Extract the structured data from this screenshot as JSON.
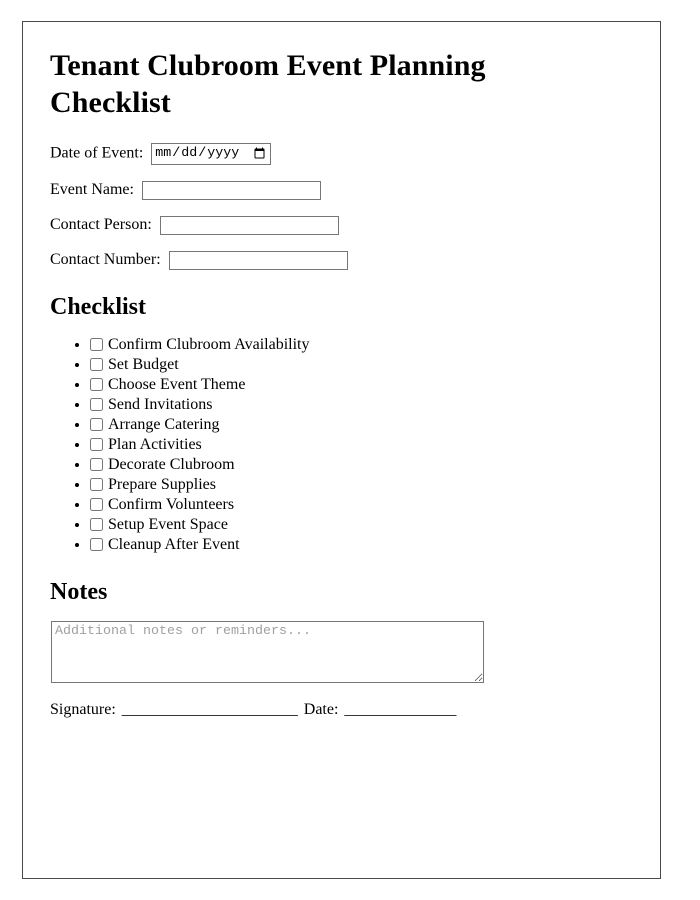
{
  "document": {
    "title": "Tenant Clubroom Event Planning Checklist"
  },
  "fields": [
    {
      "label": "Date of Event:",
      "type": "date",
      "value": "",
      "placeholder": "mm/dd/yyyy",
      "name": "date-of-event"
    },
    {
      "label": "Event Name:",
      "type": "text",
      "value": "",
      "placeholder": "",
      "name": "event-name"
    },
    {
      "label": "Contact Person:",
      "type": "text",
      "value": "",
      "placeholder": "",
      "name": "contact-person"
    },
    {
      "label": "Contact Number:",
      "type": "text",
      "value": "",
      "placeholder": "",
      "name": "contact-number"
    }
  ],
  "checklist": {
    "heading": "Checklist",
    "items": [
      {
        "label": "Confirm Clubroom Availability",
        "checked": false
      },
      {
        "label": "Set Budget",
        "checked": false
      },
      {
        "label": "Choose Event Theme",
        "checked": false
      },
      {
        "label": "Send Invitations",
        "checked": false
      },
      {
        "label": "Arrange Catering",
        "checked": false
      },
      {
        "label": "Plan Activities",
        "checked": false
      },
      {
        "label": "Decorate Clubroom",
        "checked": false
      },
      {
        "label": "Prepare Supplies",
        "checked": false
      },
      {
        "label": "Confirm Volunteers",
        "checked": false
      },
      {
        "label": "Setup Event Space",
        "checked": false
      },
      {
        "label": "Cleanup After Event",
        "checked": false
      }
    ]
  },
  "notes": {
    "heading": "Notes",
    "placeholder": "Additional notes or reminders...",
    "value": ""
  },
  "signature": {
    "signature_label": "Signature:",
    "signature_blank": "______________________",
    "date_label": "Date:",
    "date_blank": "______________"
  },
  "colors": {
    "page_border": "#4a4a4a",
    "field_border": "#767676",
    "text": "#000000",
    "placeholder": "#a0a0a0",
    "background": "#ffffff"
  }
}
